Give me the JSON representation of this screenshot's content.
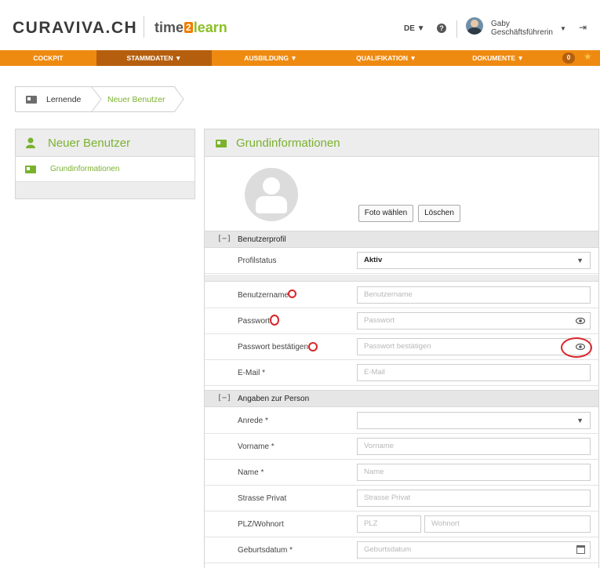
{
  "header": {
    "logo_main": "CURAVIVA.CH",
    "logo_time": "time",
    "logo_two": "2",
    "logo_learn": "learn",
    "language": "DE ▼",
    "user_first": "Gaby",
    "user_role": "Geschäftsführerin",
    "user_caret": "▼"
  },
  "nav": {
    "items": [
      {
        "label": "COCKPIT"
      },
      {
        "label": "STAMMDATEN ▼"
      },
      {
        "label": "AUSBILDUNG ▼"
      },
      {
        "label": "QUALIFIKATION ▼"
      },
      {
        "label": "DOKUMENTE ▼"
      }
    ],
    "badge": "0"
  },
  "breadcrumb": {
    "items": [
      {
        "label": "Lernende"
      },
      {
        "label": "Neuer Benutzer"
      }
    ]
  },
  "sidebar": {
    "title": "Neuer Benutzer",
    "items": [
      {
        "label": "Grundinformationen"
      }
    ]
  },
  "main": {
    "title": "Grundinformationen",
    "photo_button": "Foto wählen",
    "delete_button": "Löschen",
    "sections": {
      "profile": {
        "toggle": "[−]",
        "label": "Benutzerprofil"
      },
      "person": {
        "toggle": "[−]",
        "label": "Angaben zur Person"
      }
    },
    "fields": {
      "profilstatus": {
        "label": "Profilstatus",
        "value": "Aktiv"
      },
      "benutzername": {
        "label": "Benutzername",
        "placeholder": "Benutzername"
      },
      "passwort": {
        "label": "Passwort",
        "placeholder": "Passwort"
      },
      "passwort_bestaetigen": {
        "label": "Passwort bestätigen",
        "placeholder": "Passwort bestätigen"
      },
      "email": {
        "label": "E-Mail *",
        "placeholder": "E-Mail"
      },
      "anrede": {
        "label": "Anrede *",
        "value": ""
      },
      "vorname": {
        "label": "Vorname *",
        "placeholder": "Vorname"
      },
      "name": {
        "label": "Name *",
        "placeholder": "Name"
      },
      "strasse": {
        "label": "Strasse Privat",
        "placeholder": "Strasse Privat"
      },
      "plz_ort": {
        "label": "PLZ/Wohnort",
        "plz_placeholder": "PLZ",
        "ort_placeholder": "Wohnort"
      },
      "geburtsdatum": {
        "label": "Geburtsdatum *",
        "placeholder": "Geburtsdatum"
      }
    }
  },
  "colors": {
    "accent_orange": "#ef8a10",
    "accent_dark_orange": "#b55f0e",
    "accent_green": "#7ab22e",
    "annotation_red": "#d8262b"
  }
}
